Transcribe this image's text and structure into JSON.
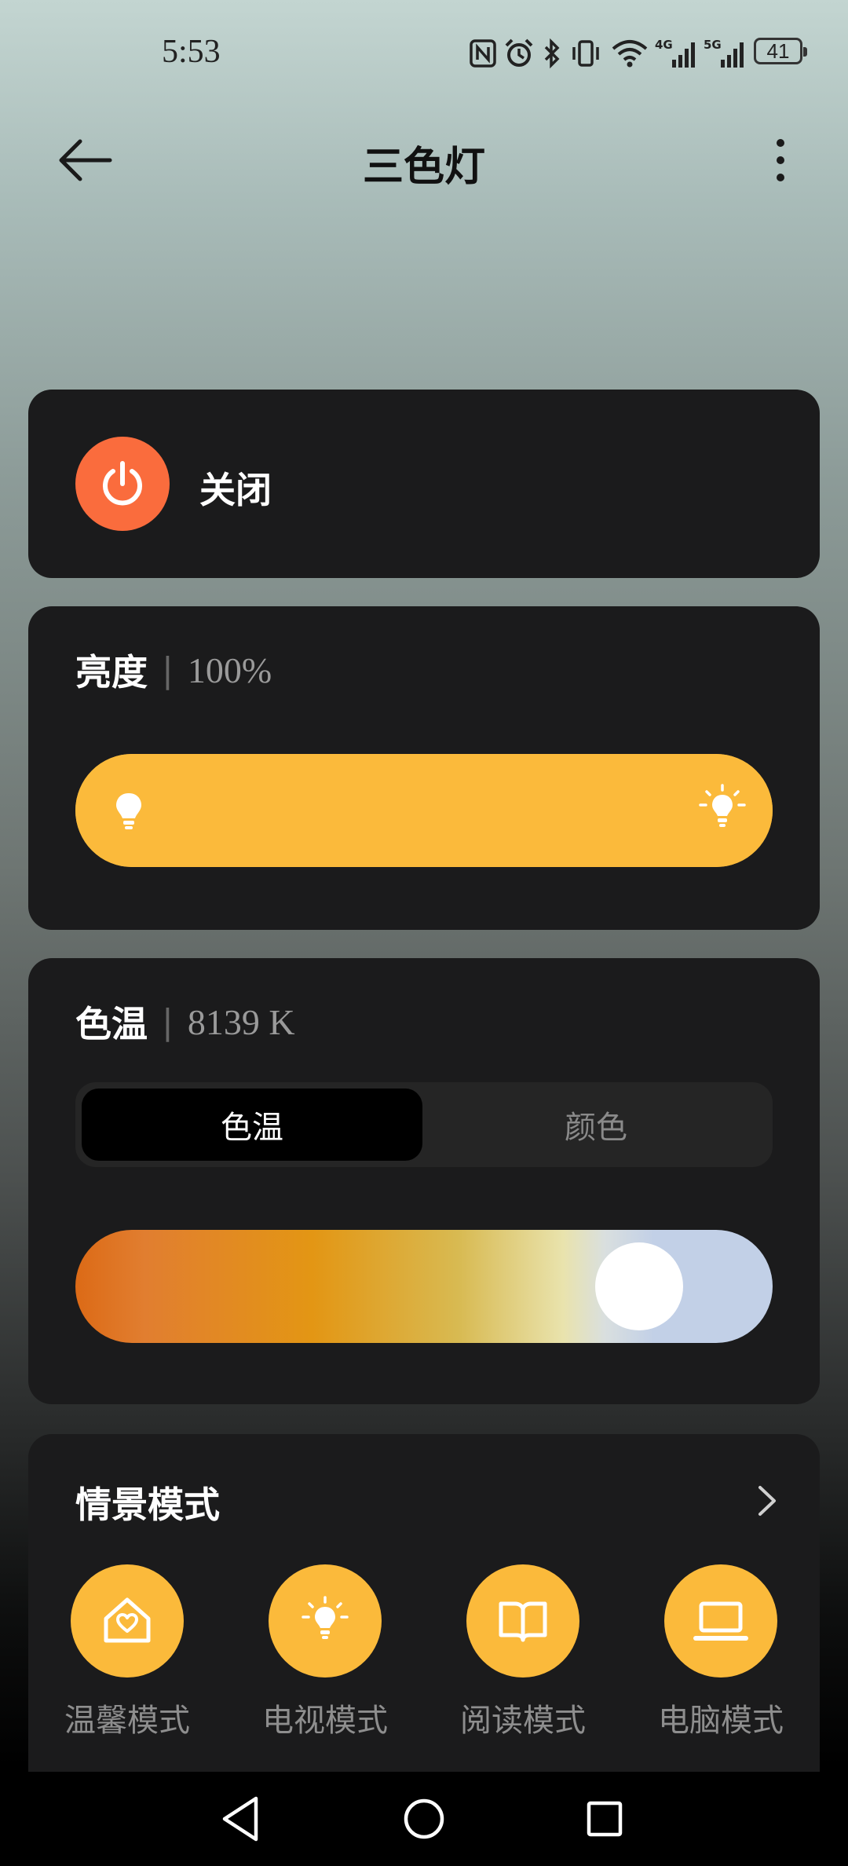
{
  "status_bar": {
    "time": "5:53",
    "battery": "41",
    "icons": [
      "nfc-icon",
      "alarm-icon",
      "bluetooth-icon",
      "vibrate-icon",
      "wifi-icon",
      "signal-4g-icon",
      "signal-5g-icon"
    ]
  },
  "header": {
    "title": "三色灯",
    "back_icon": "back-arrow-icon",
    "more_icon": "more-vertical-icon"
  },
  "power": {
    "label": "关闭",
    "icon": "power-icon",
    "color": "#fa6c3d"
  },
  "brightness": {
    "title": "亮度",
    "separator": "|",
    "value": "100%",
    "level": 1.0,
    "color": "#fbba3b"
  },
  "color_temperature": {
    "title": "色温",
    "separator": "|",
    "value": "8139 K",
    "tabs": [
      {
        "label": "色温",
        "selected": true
      },
      {
        "label": "颜色",
        "selected": false
      }
    ]
  },
  "scenes": {
    "title": "情景模式",
    "items": [
      {
        "label": "温馨模式",
        "icon": "home-heart-icon"
      },
      {
        "label": "电视模式",
        "icon": "bulb-icon"
      },
      {
        "label": "阅读模式",
        "icon": "book-icon"
      },
      {
        "label": "电脑模式",
        "icon": "laptop-icon"
      }
    ]
  },
  "nav_bar": {
    "icons": [
      "nav-back-icon",
      "nav-home-icon",
      "nav-recents-icon"
    ]
  }
}
